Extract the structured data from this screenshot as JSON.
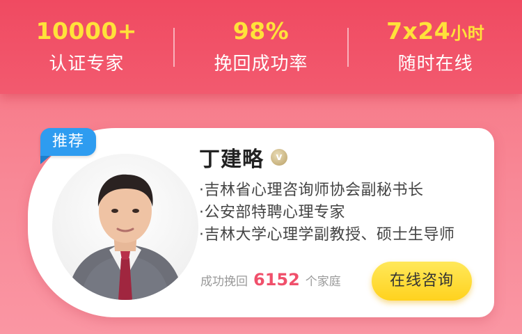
{
  "stats": [
    {
      "value": "10000+",
      "unit": "",
      "label": "认证专家"
    },
    {
      "value": "98%",
      "unit": "",
      "label": "挽回成功率"
    },
    {
      "value": "7x24",
      "unit": "小时",
      "label": "随时在线"
    }
  ],
  "expert": {
    "badge": "推荐",
    "name": "丁建略",
    "verified_icon": "verified-v-icon",
    "verified_glyph": "v",
    "titles": [
      "·吉林省心理咨询师协会副秘书长",
      "·公安部特聘心理专家",
      "·吉林大学心理学副教授、硕士生导师"
    ],
    "help_prefix": "成功挽回",
    "help_count": "6152",
    "help_suffix": "个家庭",
    "consult_label": "在线咨询"
  },
  "colors": {
    "brand": "#f04a61",
    "stat_value": "#ffe23a",
    "count": "#f0506b",
    "button": "#ffd21e",
    "badge": "#2e9cf0"
  }
}
